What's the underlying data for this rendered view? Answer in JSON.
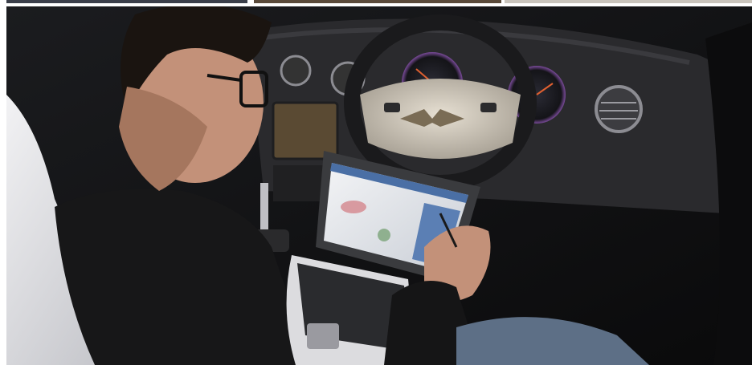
{
  "photo": {
    "subject": "technician-with-diagnostic-laptop-in-car",
    "colors": {
      "interior_dark": "#141414",
      "dashboard": "#2a2a2c",
      "steering_wheel_cream": "#d9d2c6",
      "laptop_screen": "#e9ecef",
      "laptop_ui_accent": "#4a6fa5",
      "seat_cover": "#e8e8ea",
      "skin": "#c99a7f",
      "shirt": "#1a1a1a",
      "gauge_glow": "#6a2f8f"
    }
  }
}
